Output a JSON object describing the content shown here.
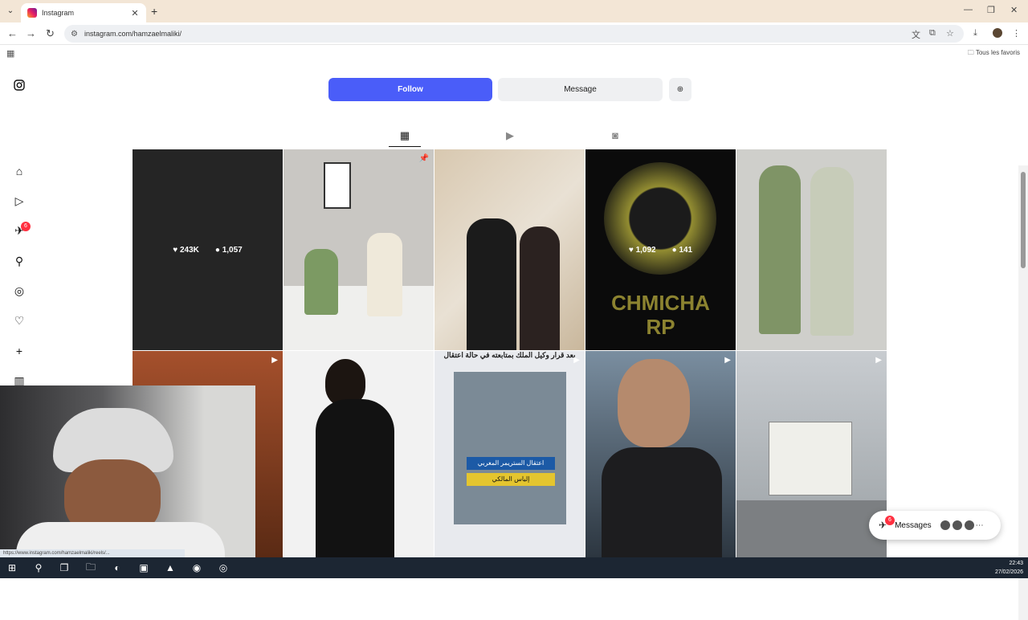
{
  "browser": {
    "tab_title": "Instagram",
    "url": "instagram.com/hamzaelmaliki/",
    "bookmarks_folder": "Tous les favoris",
    "status_url": "https://www.instagram.com/hamzaelmaliki/reels/..."
  },
  "profile": {
    "follow_label": "Follow",
    "message_label": "Message"
  },
  "sidebar": {
    "notifications_badge": "6"
  },
  "grid": {
    "posts": [
      {
        "likes": "243K",
        "comments": "1,057"
      },
      {},
      {},
      {
        "likes": "1,092",
        "comments": "141",
        "text": "CHMICHA",
        "text2": "RP"
      },
      {},
      {},
      {},
      {
        "headline": "بعد قرار وكيل الملك بمتابعته في حالة اعتقال",
        "caption1": "اعتقال الستريمر المغربي",
        "caption2": "إلياس المالكي"
      },
      {},
      {}
    ]
  },
  "messages": {
    "label": "Messages",
    "badge": "6"
  },
  "taskbar": {
    "time": "22:43",
    "date": "27/02/2026"
  },
  "colors": {
    "follow_button": "#4a5df9",
    "badge": "#ff3040",
    "taskbar": "#1c2633",
    "titlebar": "#f3e6d6"
  }
}
